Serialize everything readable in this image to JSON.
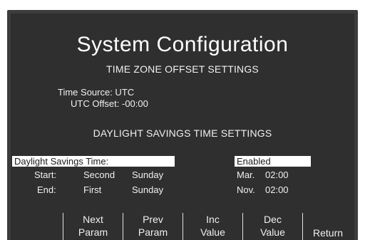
{
  "screen": {
    "title": "System Configuration",
    "tz_section": {
      "heading": "TIME ZONE OFFSET SETTINGS",
      "time_source": "Time Source: UTC",
      "utc_offset": "UTC Offset: -00:00"
    },
    "dst_section": {
      "heading": "DAYLIGHT SAVINGS TIME SETTINGS",
      "dst_label": "Daylight Savings Time:",
      "dst_value": "Enabled",
      "start": {
        "label": "Start:",
        "week": "Second",
        "day": "Sunday",
        "month": "Mar.",
        "time": "02:00"
      },
      "end": {
        "label": "End:",
        "week": "First",
        "day": "Sunday",
        "month": "Nov.",
        "time": "02:00"
      }
    },
    "softkeys": [
      {
        "line1": "Next",
        "line2": "Param"
      },
      {
        "line1": "Prev",
        "line2": "Param"
      },
      {
        "line1": "Inc",
        "line2": "Value"
      },
      {
        "line1": "Dec",
        "line2": "Value"
      }
    ],
    "return_label": "Return"
  },
  "colors": {
    "screen_bg": "#2f2f2f",
    "bezel": "#3c3c3c",
    "text": "#f0f0f0",
    "highlight_bg": "#ffffff",
    "highlight_text": "#1a1a1a"
  }
}
